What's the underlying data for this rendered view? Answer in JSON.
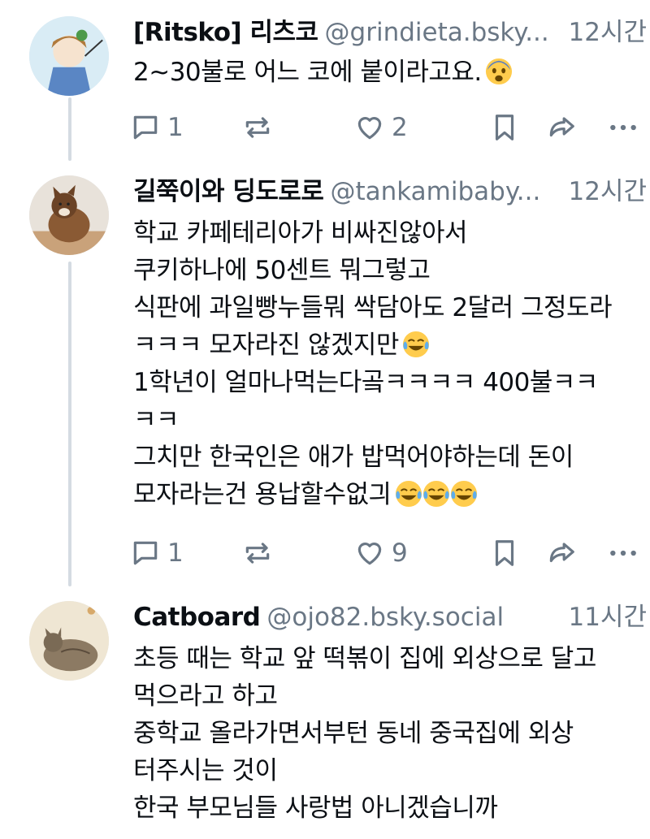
{
  "posts": [
    {
      "display_name": "[Ritsko] 리츠코",
      "handle": "@grindieta.bsky...",
      "time": "12시간",
      "lines": [
        "2~30불로 어느 코에 붙이라고요."
      ],
      "actions": {
        "reply_count": "1",
        "like_count": "2"
      }
    },
    {
      "display_name": "길쭉이와 딩도로로",
      "handle": "@tankamibaby...",
      "time": "12시간",
      "lines": [
        "학교 카페테리아가 비싸진않아서",
        "쿠키하나에 50센트 뭐그렇고",
        "식판에 과일빵누들뭐 싹담아도 2달러 그정도라",
        "ㅋㅋㅋ 모자라진 않겠지만",
        "1학년이 얼마나먹는다곸ㅋㅋㅋㅋ 400불ㅋㅋ",
        "ㅋㅋ",
        "그치만 한국인은 애가 밥먹어야하는데 돈이",
        "모자라는건 용납할수없긔"
      ],
      "actions": {
        "reply_count": "1",
        "like_count": "9"
      }
    },
    {
      "display_name": "Catboard",
      "handle": "@ojo82.bsky.social",
      "time": "11시간",
      "lines": [
        "초등 때는 학교 앞 떡볶이 집에 외상으로 달고",
        "먹으라고 하고",
        "중학교 올라가면서부턴 동네 중국집에 외상",
        "터주시는 것이",
        "한국 부모님들 사랑법 아니겠습니까"
      ]
    }
  ],
  "emojis": {
    "fearful": "fearful-face",
    "laughing": "face-with-tears-of-joy"
  },
  "colors": {
    "text": "#0b0f14",
    "muted": "#6a7785",
    "thread": "#d4dbe2"
  }
}
